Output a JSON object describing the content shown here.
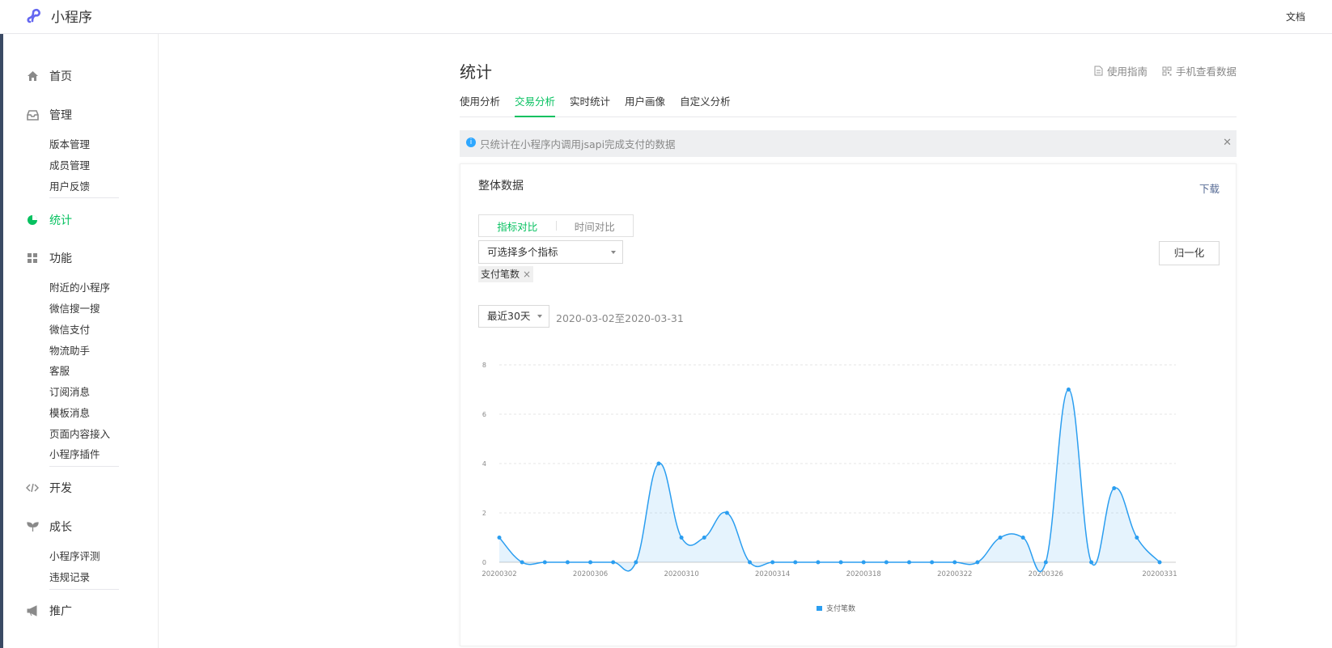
{
  "header": {
    "app_name": "小程序",
    "doc_link": "文档"
  },
  "sidebar": {
    "home": "首页",
    "manage": {
      "label": "管理",
      "items": [
        "版本管理",
        "成员管理",
        "用户反馈"
      ]
    },
    "stats": "统计",
    "features": {
      "label": "功能",
      "items": [
        "附近的小程序",
        "微信搜一搜",
        "微信支付",
        "物流助手",
        "客服",
        "订阅消息",
        "模板消息",
        "页面内容接入",
        "小程序插件"
      ]
    },
    "develop": "开发",
    "growth": {
      "label": "成长",
      "items": [
        "小程序评测",
        "违规记录"
      ]
    },
    "promote": "推广"
  },
  "page": {
    "title": "统计",
    "guide": "使用指南",
    "mobile": "手机查看数据",
    "tabs": [
      "使用分析",
      "交易分析",
      "实时统计",
      "用户画像",
      "自定义分析"
    ],
    "active_tab": 1,
    "notice": "只统计在小程序内调用jsapi完成支付的数据"
  },
  "card": {
    "title": "整体数据",
    "download": "下载",
    "seg": [
      "指标对比",
      "时间对比"
    ],
    "select_placeholder": "可选择多个指标",
    "normalize": "归一化",
    "tag": "支付笔数",
    "range": "最近30天",
    "date_range": "2020-03-02至2020-03-31"
  },
  "colors": {
    "accent": "#07c160",
    "line": "#2b9ef0",
    "link": "#576b95"
  },
  "chart_data": {
    "type": "area",
    "x": [
      "20200302",
      "20200303",
      "20200304",
      "20200305",
      "20200306",
      "20200307",
      "20200308",
      "20200309",
      "20200310",
      "20200311",
      "20200312",
      "20200313",
      "20200314",
      "20200315",
      "20200316",
      "20200317",
      "20200318",
      "20200319",
      "20200320",
      "20200321",
      "20200322",
      "20200323",
      "20200324",
      "20200325",
      "20200326",
      "20200327",
      "20200328",
      "20200329",
      "20200330",
      "20200331"
    ],
    "series": [
      {
        "name": "支付笔数",
        "values": [
          1,
          0,
          0,
          0,
          0,
          0,
          0,
          4,
          1,
          1,
          2,
          0,
          0,
          0,
          0,
          0,
          0,
          0,
          0,
          0,
          0,
          0,
          1,
          1,
          0,
          7,
          0,
          3,
          1,
          0
        ]
      }
    ],
    "x_tick_labels": [
      "20200302",
      "20200306",
      "20200310",
      "20200314",
      "20200318",
      "20200322",
      "20200326",
      "20200331"
    ],
    "y_ticks": [
      0,
      2,
      4,
      6,
      8
    ],
    "ylim": [
      0,
      8
    ],
    "grid": true,
    "legend": "bottom"
  }
}
